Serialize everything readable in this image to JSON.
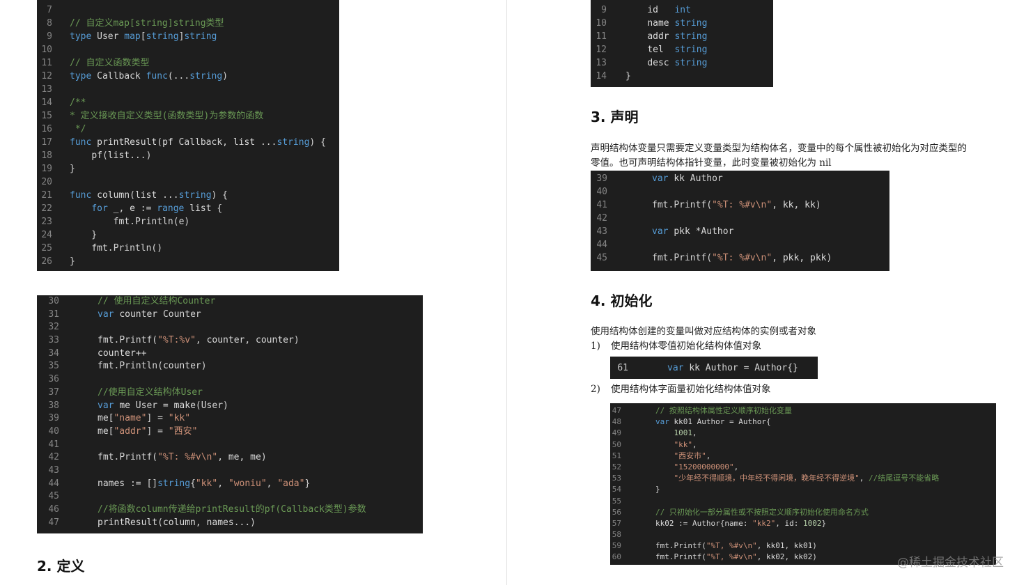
{
  "blocks": [
    {
      "id": "code-user-callback",
      "lines": [
        [
          "7",
          ""
        ],
        [
          "8",
          "// 自定义map[string]string类型"
        ],
        [
          "9",
          "type User map[string]string"
        ],
        [
          "10",
          ""
        ],
        [
          "11",
          "// 自定义函数类型"
        ],
        [
          "12",
          "type Callback func(...string)"
        ],
        [
          "13",
          ""
        ],
        [
          "14",
          "/**"
        ],
        [
          "15",
          "* 定义接收自定义类型(函数类型)为参数的函数"
        ],
        [
          "16",
          " */"
        ],
        [
          "17",
          "func printResult(pf Callback, list ...string) {"
        ],
        [
          "18",
          "    pf(list...)"
        ],
        [
          "19",
          "}"
        ],
        [
          "20",
          ""
        ],
        [
          "21",
          "func column(list ...string) {"
        ],
        [
          "22",
          "    for _, e := range list {"
        ],
        [
          "23",
          "        fmt.Println(e)"
        ],
        [
          "24",
          "    }"
        ],
        [
          "25",
          "    fmt.Println()"
        ],
        [
          "26",
          "}"
        ]
      ]
    },
    {
      "id": "code-counter-user",
      "lines": [
        [
          "30",
          "// 使用自定义结构Counter"
        ],
        [
          "31",
          "var counter Counter"
        ],
        [
          "32",
          ""
        ],
        [
          "33",
          "fmt.Printf(\"%T:%v\", counter, counter)"
        ],
        [
          "34",
          "counter++"
        ],
        [
          "35",
          "fmt.Println(counter)"
        ],
        [
          "36",
          ""
        ],
        [
          "37",
          "//使用自定义结构体User"
        ],
        [
          "38",
          "var me User = make(User)"
        ],
        [
          "39",
          "me[\"name\"] = \"kk\""
        ],
        [
          "40",
          "me[\"addr\"] = \"西安\""
        ],
        [
          "41",
          ""
        ],
        [
          "42",
          "fmt.Printf(\"%T: %#v\\n\", me, me)"
        ],
        [
          "43",
          ""
        ],
        [
          "44",
          "names := []string{\"kk\", \"woniu\", \"ada\"}"
        ],
        [
          "45",
          ""
        ],
        [
          "46",
          "//将函数column传递给printResult的pf(Callback类型)参数"
        ],
        [
          "47",
          "printResult(column, names...)"
        ]
      ]
    },
    {
      "id": "code-author-struct",
      "lines": [
        [
          "9",
          "    id   int"
        ],
        [
          "10",
          "    name string"
        ],
        [
          "11",
          "    addr string"
        ],
        [
          "12",
          "    tel  string"
        ],
        [
          "13",
          "    desc string"
        ],
        [
          "14",
          "}"
        ]
      ]
    },
    {
      "id": "code-declare",
      "lines": [
        [
          "39",
          "var kk Author"
        ],
        [
          "40",
          ""
        ],
        [
          "41",
          "fmt.Printf(\"%T: %#v\\n\", kk, kk)"
        ],
        [
          "42",
          ""
        ],
        [
          "43",
          "var pkk *Author"
        ],
        [
          "44",
          ""
        ],
        [
          "45",
          "fmt.Printf(\"%T: %#v\\n\", pkk, pkk)"
        ]
      ]
    },
    {
      "id": "code-zero-init",
      "lines": [
        [
          "61",
          "var kk Author = Author{}"
        ]
      ]
    },
    {
      "id": "code-literal-init",
      "lines": [
        [
          "47",
          "// 按照结构体属性定义顺序初始化变量"
        ],
        [
          "48",
          "var kk01 Author = Author{"
        ],
        [
          "49",
          "    1001,"
        ],
        [
          "50",
          "    \"kk\","
        ],
        [
          "51",
          "    \"西安市\","
        ],
        [
          "52",
          "    \"15200000000\","
        ],
        [
          "53",
          "    \"少年经不得顺境，中年经不得闲境，晚年经不得逆境\", //结尾逗号不能省略"
        ],
        [
          "54",
          "}"
        ],
        [
          "55",
          ""
        ],
        [
          "56",
          "// 只初始化一部分属性或不按照定义顺序初始化使用命名方式"
        ],
        [
          "57",
          "kk02 := Author{name: \"kk2\", id: 1002}"
        ],
        [
          "58",
          ""
        ],
        [
          "59",
          "fmt.Printf(\"%T, %#v\\n\", kk01, kk01)"
        ],
        [
          "60",
          "fmt.Printf(\"%T, %#v\\n\", kk02, kk02)"
        ]
      ]
    }
  ],
  "headings": {
    "definition": "2. 定义",
    "declaration": "3. 声明",
    "initialization": "4. 初始化"
  },
  "paragraphs": {
    "declaration_line1": "声明结构体变量只需要定义变量类型为结构体名，变量中的每个属性被初始化为对应类型的",
    "declaration_line2": "零值。也可声明结构体指针变量，此时变量被初始化为 nil",
    "init_intro": "使用结构体创建的变量叫做对应结构体的实例或者对象",
    "init_item1_num": "1)",
    "init_item1": "使用结构体零值初始化结构体值对象",
    "init_item2_num": "2)",
    "init_item2": "使用结构体字面量初始化结构体值对象"
  },
  "watermark": "@稀土掘金技术社区"
}
